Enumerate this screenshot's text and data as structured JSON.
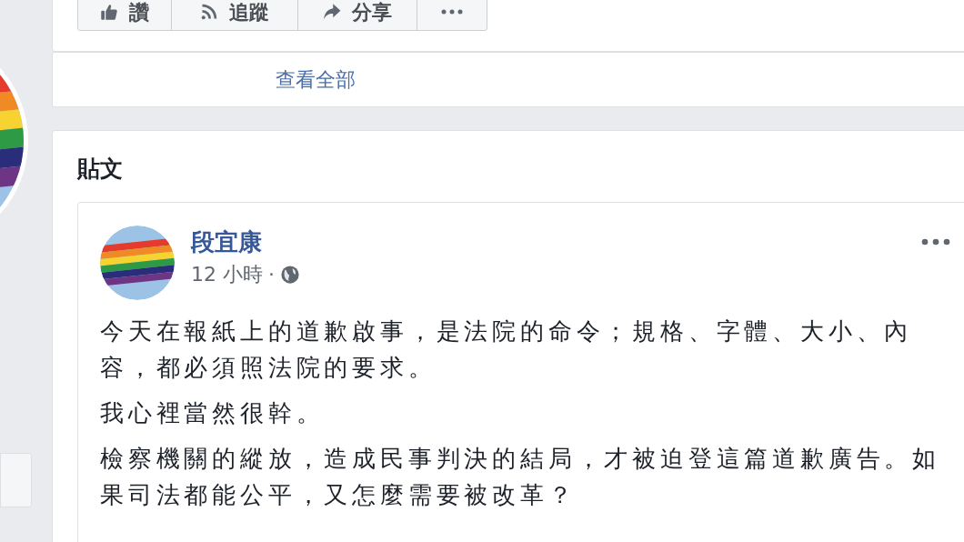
{
  "page_actions": [
    {
      "kind": "like",
      "label": "讚"
    },
    {
      "kind": "follow",
      "label": "追蹤"
    },
    {
      "kind": "share",
      "label": "分享"
    },
    {
      "kind": "more"
    }
  ],
  "see_all": "查看全部",
  "posts": {
    "title": "貼文",
    "items": [
      {
        "author": "段宜康",
        "time": "12 小時",
        "separator": "·",
        "paragraphs": [
          "今天在報紙上的道歉啟事，是法院的命令；規格、字體、大小、內容，都必須照法院的要求。",
          "我心裡當然很幹。",
          "檢察機關的縱放，造成民事判決的結局，才被迫登這篇道歉廣告。如果司法都能公平，又怎麼需要被改革？"
        ]
      }
    ]
  }
}
